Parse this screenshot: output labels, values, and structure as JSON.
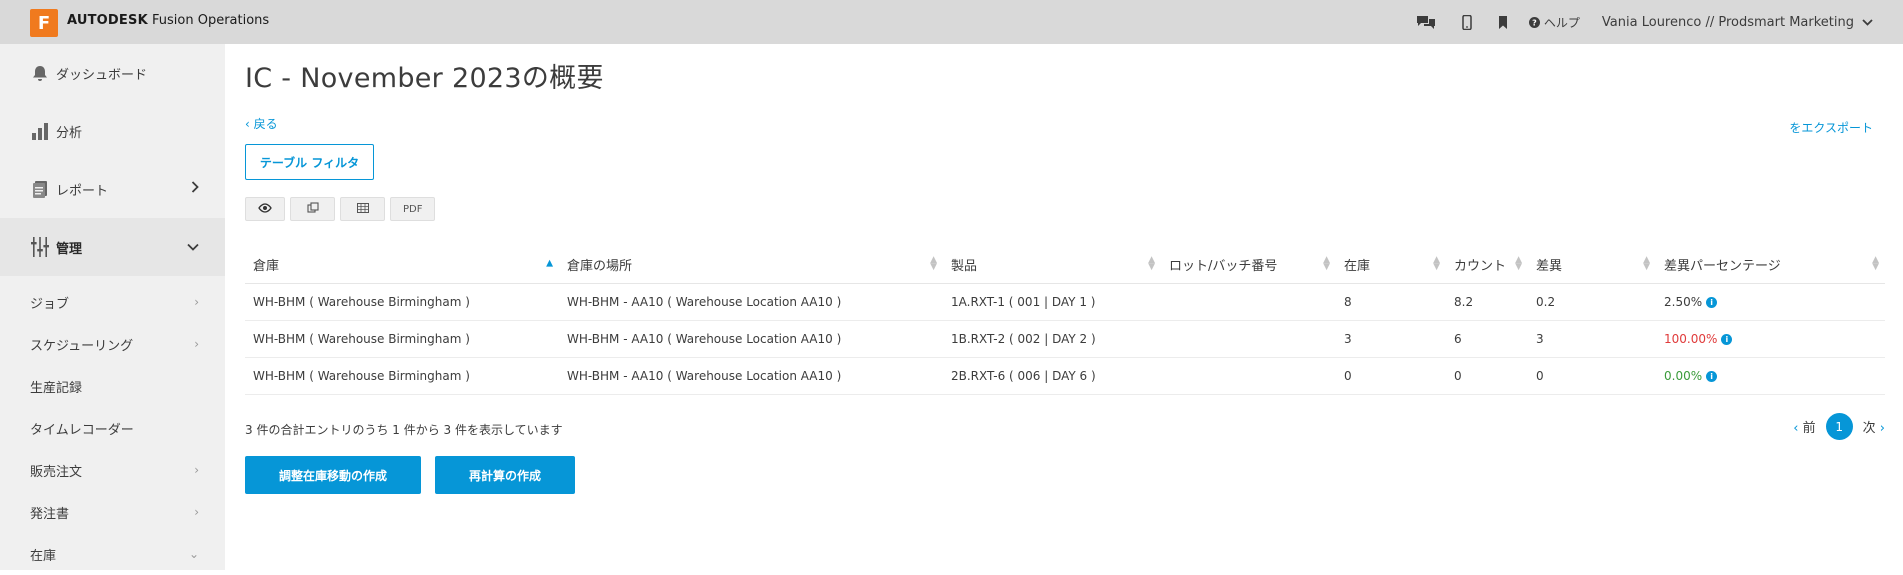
{
  "header": {
    "logo_letter": "F",
    "brand_strong": "AUTODESK",
    "brand_rest": " Fusion Operations",
    "icons": [
      "chat-icon",
      "mobile-icon",
      "bookmark-icon"
    ],
    "help_label": "ヘルプ",
    "user": "Vania Lourenco // Prodsmart Marketing"
  },
  "sidebar": {
    "items": [
      {
        "label": "ダッシュボード",
        "icon": "bell-icon"
      },
      {
        "label": "分析",
        "icon": "bar-chart-icon"
      },
      {
        "label": "レポート",
        "icon": "report-icon"
      },
      {
        "label": "管理",
        "icon": "sliders-icon"
      }
    ],
    "sub_items": [
      {
        "label": "ジョブ",
        "chevron": "›"
      },
      {
        "label": "スケジューリング",
        "chevron": "›"
      },
      {
        "label": "生産記録",
        "chevron": ""
      },
      {
        "label": "タイムレコーダー",
        "chevron": ""
      },
      {
        "label": "販売注文",
        "chevron": "›"
      },
      {
        "label": "発注書",
        "chevron": "›"
      },
      {
        "label": "在庫",
        "chevron": "⌄"
      }
    ]
  },
  "page": {
    "title": "IC - November 2023の概要",
    "back": "‹ 戻る",
    "export": "をエクスポート",
    "filter_button": "テーブル フィルタ",
    "tools": [
      "👁",
      "⧉",
      "▦",
      "PDF"
    ]
  },
  "table": {
    "headers": [
      "倉庫",
      "倉庫の場所",
      "製品",
      "ロット/バッチ番号",
      "在庫",
      "カウント",
      "差異",
      "差異パーセンテージ"
    ],
    "rows": [
      {
        "warehouse": "WH-BHM ( Warehouse Birmingham )",
        "location": "WH-BHM - AA10 ( Warehouse Location AA10 )",
        "product": "1A.RXT-1 ( 001 | DAY 1 )",
        "lot": "",
        "stock": "8",
        "count": "8.2",
        "diff": "0.2",
        "pct": "2.50%"
      },
      {
        "warehouse": "WH-BHM ( Warehouse Birmingham )",
        "location": "WH-BHM - AA10 ( Warehouse Location AA10 )",
        "product": "1B.RXT-2 ( 002 | DAY 2 )",
        "lot": "",
        "stock": "3",
        "count": "6",
        "diff": "3",
        "pct": "100.00%"
      },
      {
        "warehouse": "WH-BHM ( Warehouse Birmingham )",
        "location": "WH-BHM - AA10 ( Warehouse Location AA10 )",
        "product": "2B.RXT-6 ( 006 | DAY 6 )",
        "lot": "",
        "stock": "0",
        "count": "0",
        "diff": "0",
        "pct": "0.00%"
      }
    ]
  },
  "footer": {
    "entries": "3 件の合計エントリのうち 1 件から 3 件を表示しています",
    "prev": "前",
    "current_page": "1",
    "next": "次",
    "create_adjustment": "調整在庫移動の作成",
    "create_recount": "再計算の作成"
  },
  "colors": {
    "accent": "#0696d7",
    "logo": "#f07a1e",
    "negative": "#e03b3b",
    "positive": "#3a9b3a"
  }
}
